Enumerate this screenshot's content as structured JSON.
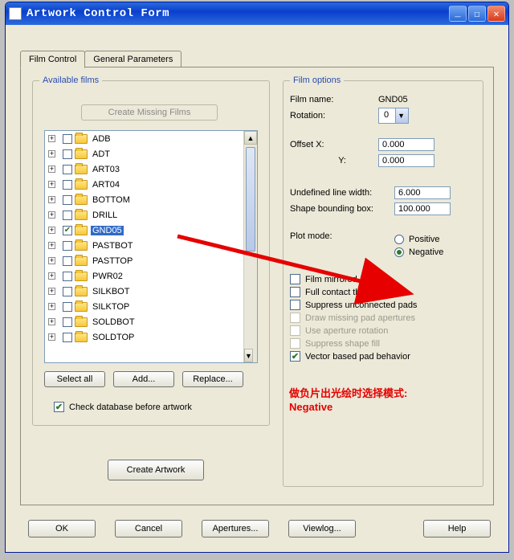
{
  "window": {
    "title": "Artwork Control Form"
  },
  "tabs": {
    "film_control": "Film Control",
    "general_params": "General Parameters"
  },
  "films": {
    "legend": "Available films",
    "create_missing": "Create Missing Films",
    "items": [
      {
        "label": "ADB",
        "checked": false
      },
      {
        "label": "ADT",
        "checked": false
      },
      {
        "label": "ART03",
        "checked": false
      },
      {
        "label": "ART04",
        "checked": false
      },
      {
        "label": "BOTTOM",
        "checked": false
      },
      {
        "label": "DRILL",
        "checked": false
      },
      {
        "label": "GND05",
        "checked": true,
        "selected": true
      },
      {
        "label": "PASTBOT",
        "checked": false
      },
      {
        "label": "PASTTOP",
        "checked": false
      },
      {
        "label": "PWR02",
        "checked": false
      },
      {
        "label": "SILKBOT",
        "checked": false
      },
      {
        "label": "SILKTOP",
        "checked": false
      },
      {
        "label": "SOLDBOT",
        "checked": false
      },
      {
        "label": "SOLDTOP",
        "checked": false
      }
    ],
    "select_all": "Select all",
    "add": "Add...",
    "replace": "Replace...",
    "check_db": "Check database before artwork",
    "check_db_checked": true,
    "create_artwork": "Create Artwork"
  },
  "options": {
    "legend": "Film options",
    "film_name_label": "Film name:",
    "film_name_value": "GND05",
    "rotation_label": "Rotation:",
    "rotation_value": "0",
    "offset_x_label": "Offset  X:",
    "offset_y_label": "Y:",
    "offset_x": "0.000",
    "offset_y": "0.000",
    "undef_line_label": "Undefined line width:",
    "undef_line": "6.000",
    "shape_box_label": "Shape bounding box:",
    "shape_box": "100.000",
    "plot_mode_label": "Plot mode:",
    "positive": "Positive",
    "negative": "Negative",
    "plot_mode_selected": "negative",
    "mirrored": "Film mirrored",
    "full_contact": "Full contact thermal-reliefs",
    "suppress_unconn": "Suppress unconnected pads",
    "draw_missing": "Draw missing pad apertures",
    "use_ap_rot": "Use aperture rotation",
    "suppress_shape": "Suppress shape fill",
    "vector_pad": "Vector based pad behavior",
    "vector_pad_checked": true
  },
  "annotation": {
    "line1": "做负片出光绘时选择模式:",
    "line2": "Negative"
  },
  "buttons": {
    "ok": "OK",
    "cancel": "Cancel",
    "apertures": "Apertures...",
    "viewlog": "Viewlog...",
    "help": "Help"
  }
}
